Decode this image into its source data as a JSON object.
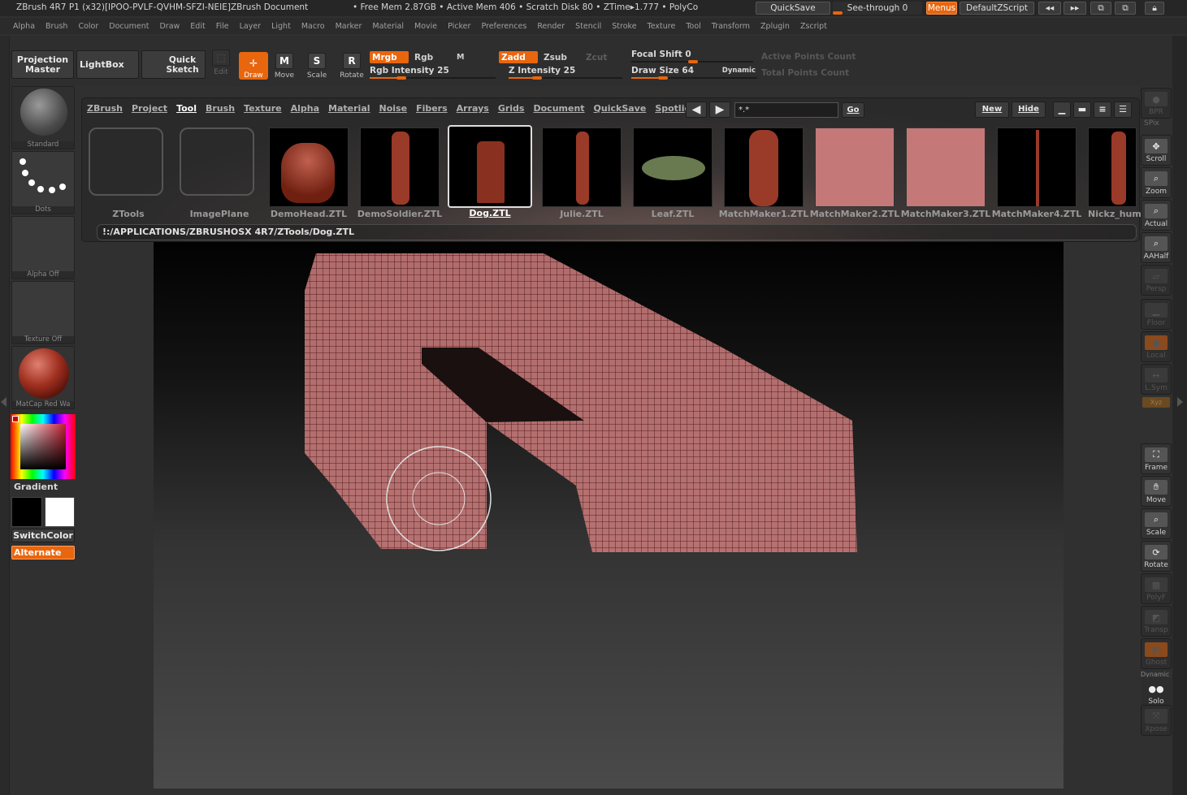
{
  "titlebar": {
    "title": "ZBrush 4R7 P1 (x32)[IPOO-PVLF-QVHM-SFZI-NEIE]ZBrush Document",
    "stats": "• Free Mem 2.87GB • Active Mem 406 • Scratch Disk 80 • ZTime▸1.777 • PolyCo",
    "quicksave": "QuickSave",
    "seethrough": "See-through  0",
    "menus": "Menus",
    "script": "DefaultZScript"
  },
  "menubar": [
    "Alpha",
    "Brush",
    "Color",
    "Document",
    "Draw",
    "Edit",
    "File",
    "Layer",
    "Light",
    "Macro",
    "Marker",
    "Material",
    "Movie",
    "Picker",
    "Preferences",
    "Render",
    "Stencil",
    "Stroke",
    "Texture",
    "Tool",
    "Transform",
    "Zplugin",
    "Zscript"
  ],
  "shelf": {
    "projection_master": "Projection Master",
    "lightbox": "LightBox",
    "quick_sketch": "Quick Sketch",
    "edit": "Edit",
    "draw": "Draw",
    "move": "Move",
    "scale": "Scale",
    "rotate": "Rotate",
    "mrgb": "Mrgb",
    "rgb": "Rgb",
    "m": "M",
    "rgb_intensity": "Rgb  Intensity 25",
    "zadd": "Zadd",
    "zsub": "Zsub",
    "zcut": "Zcut",
    "z_intensity": "Z  Intensity 25",
    "focal_shift": "Focal  Shift 0",
    "draw_size": "Draw  Size 64",
    "dynamic": "Dynamic",
    "active_points": "Active Points Count",
    "total_points": "Total Points Count",
    "rgb_intensity_value": 25,
    "z_intensity_value": 25,
    "focal_shift_value": 0,
    "draw_size_value": 64
  },
  "leftshelf": {
    "standard": "Standard",
    "dots": "Dots",
    "alpha_off": "Alpha  Off",
    "texture_off": "Texture  Off",
    "matcap": "MatCap  Red  Wa",
    "gradient": "Gradient",
    "switchcolor": "SwitchColor",
    "alternate": "Alternate"
  },
  "popup": {
    "tabs": [
      "ZBrush",
      "Project",
      "Tool",
      "Brush",
      "Texture",
      "Alpha",
      "Material",
      "Noise",
      "Fibers",
      "Arrays",
      "Grids",
      "Document",
      "QuickSave",
      "Spotlight"
    ],
    "active_tab": "Tool",
    "filter": "*.*",
    "go": "Go",
    "new": "New",
    "hide": "Hide",
    "path": "!:/APPLICATIONS/ZBRUSHOSX 4R7/ZTools/Dog.ZTL",
    "items": [
      "ZTools",
      "ImagePlane",
      "DemoHead.ZTL",
      "DemoSoldier.ZTL",
      "Dog.ZTL",
      "Julie.ZTL",
      "Leaf.ZTL",
      "MatchMaker1.ZTL",
      "MatchMaker2.ZTL",
      "MatchMaker3.ZTL",
      "MatchMaker4.ZTL",
      "Nickz_hum"
    ]
  },
  "rightshelf": [
    "BPR",
    "SPix",
    "Scroll",
    "Zoom",
    "Actual",
    "AAHalf",
    "Persp",
    "Floor",
    "Local",
    "L.Sym",
    "Xyz",
    "Frame",
    "Move",
    "Scale",
    "Rotate",
    "PolyF",
    "Transp",
    "Ghost",
    "Dynamic",
    "Solo",
    "Xpose"
  ],
  "colors": {
    "accent": "#e8660e",
    "main_color": "#000000",
    "secondary_color": "#ffffff"
  }
}
